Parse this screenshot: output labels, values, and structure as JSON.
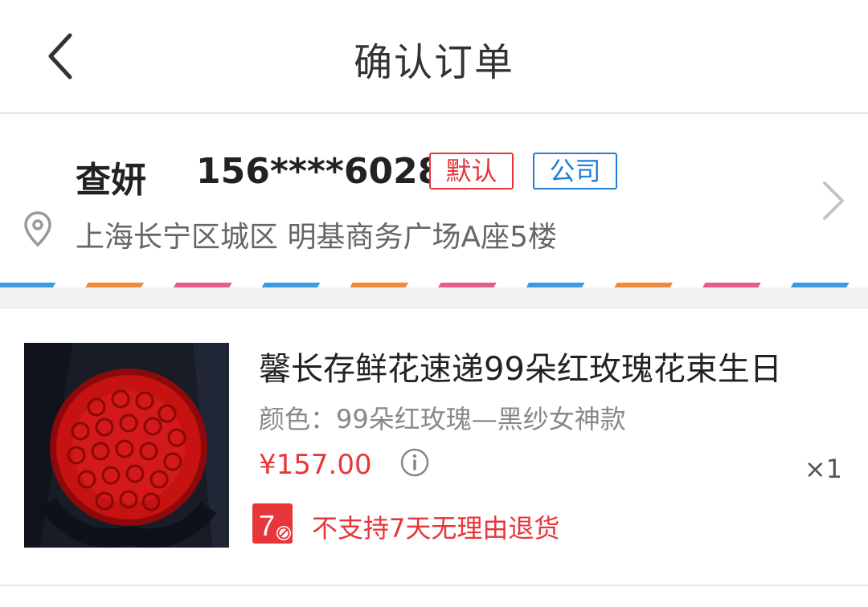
{
  "header": {
    "title": "确认订单",
    "back_icon": "chevron-left-icon"
  },
  "address": {
    "name": "查妍",
    "phone": "156****6028",
    "tag_default": "默认",
    "tag_company": "公司",
    "location_icon": "location-pin-icon",
    "detail": "上海长宁区城区 明基商务广场A座5楼",
    "arrow_icon": "chevron-right-icon"
  },
  "product": {
    "image": "red-rose-bouquet",
    "title": "馨长存鲜花速递99朵红玫瑰花束生日",
    "spec": "颜色：99朵红玫瑰—黑纱女神款",
    "price": "¥157.00",
    "info_icon": "info-icon",
    "quantity": "×1",
    "no_return_badge": "7",
    "no_return_text": "不支持7天无理由退货"
  },
  "colors": {
    "accent_red": "#e8353a",
    "tag_blue": "#1f7fd8",
    "stripe_blue": "#3c9be0",
    "stripe_orange": "#f08a3c",
    "stripe_pink": "#e65d8a"
  }
}
